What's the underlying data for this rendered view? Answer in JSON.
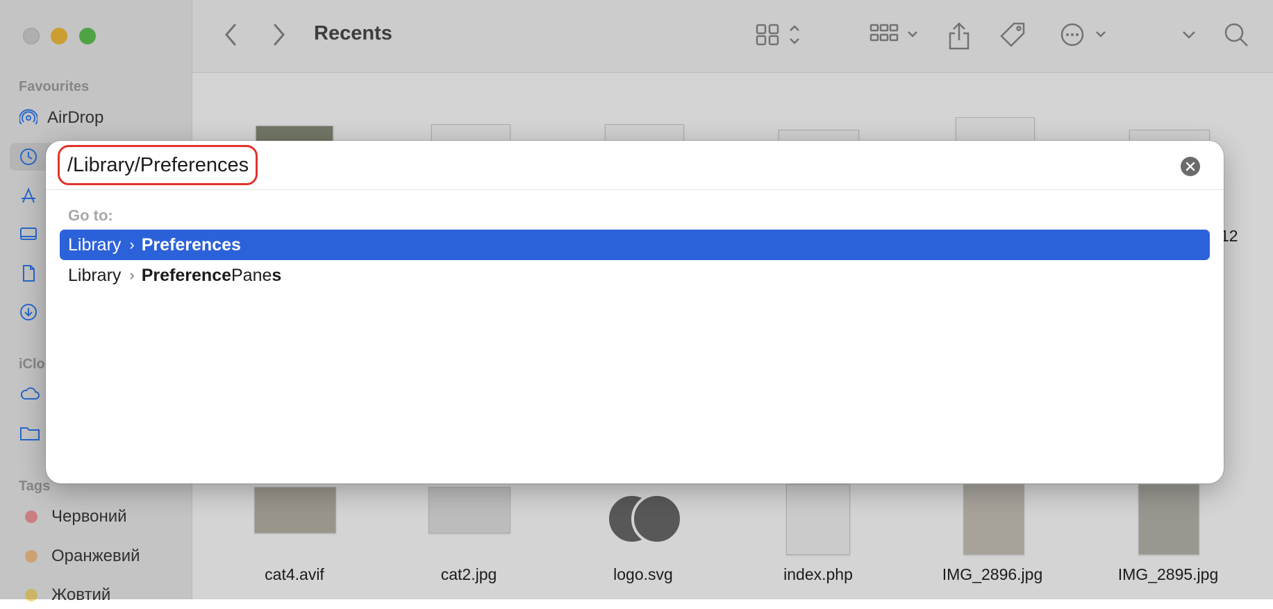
{
  "finder": {
    "toolbar": {
      "title": "Recents"
    },
    "sidebar": {
      "favourites_heading": "Favourites",
      "items": [
        {
          "label": "AirDrop",
          "icon": "airdrop-icon"
        }
      ],
      "icloud_heading": "iClo",
      "tags_heading": "Tags",
      "tags": [
        {
          "label": "Червоний",
          "color": "#f4989a"
        },
        {
          "label": "Оранжевий",
          "color": "#f7c38a"
        },
        {
          "label": "Жовтий",
          "color": "#f5db7a"
        }
      ]
    },
    "files": [
      {
        "name": "cat4.avif"
      },
      {
        "name": "cat2.jpg"
      },
      {
        "name": "logo.svg"
      },
      {
        "name": "index.php"
      },
      {
        "name": "IMG_2896.jpg"
      },
      {
        "name": "IMG_2895.jpg"
      }
    ],
    "partial_text": "12"
  },
  "dialog": {
    "path_value": "/Library/Preferences",
    "goto_label": "Go to:",
    "results": [
      {
        "parent": "Library",
        "match_bold": "Preferences",
        "rest": "",
        "rest_bold": "",
        "selected": true
      },
      {
        "parent": "Library",
        "match_bold": "Preference",
        "rest": "Pane",
        "rest_bold": "s",
        "selected": false
      }
    ],
    "accent_color": "#2b62d9",
    "highlight_border_color": "#e0342b"
  }
}
